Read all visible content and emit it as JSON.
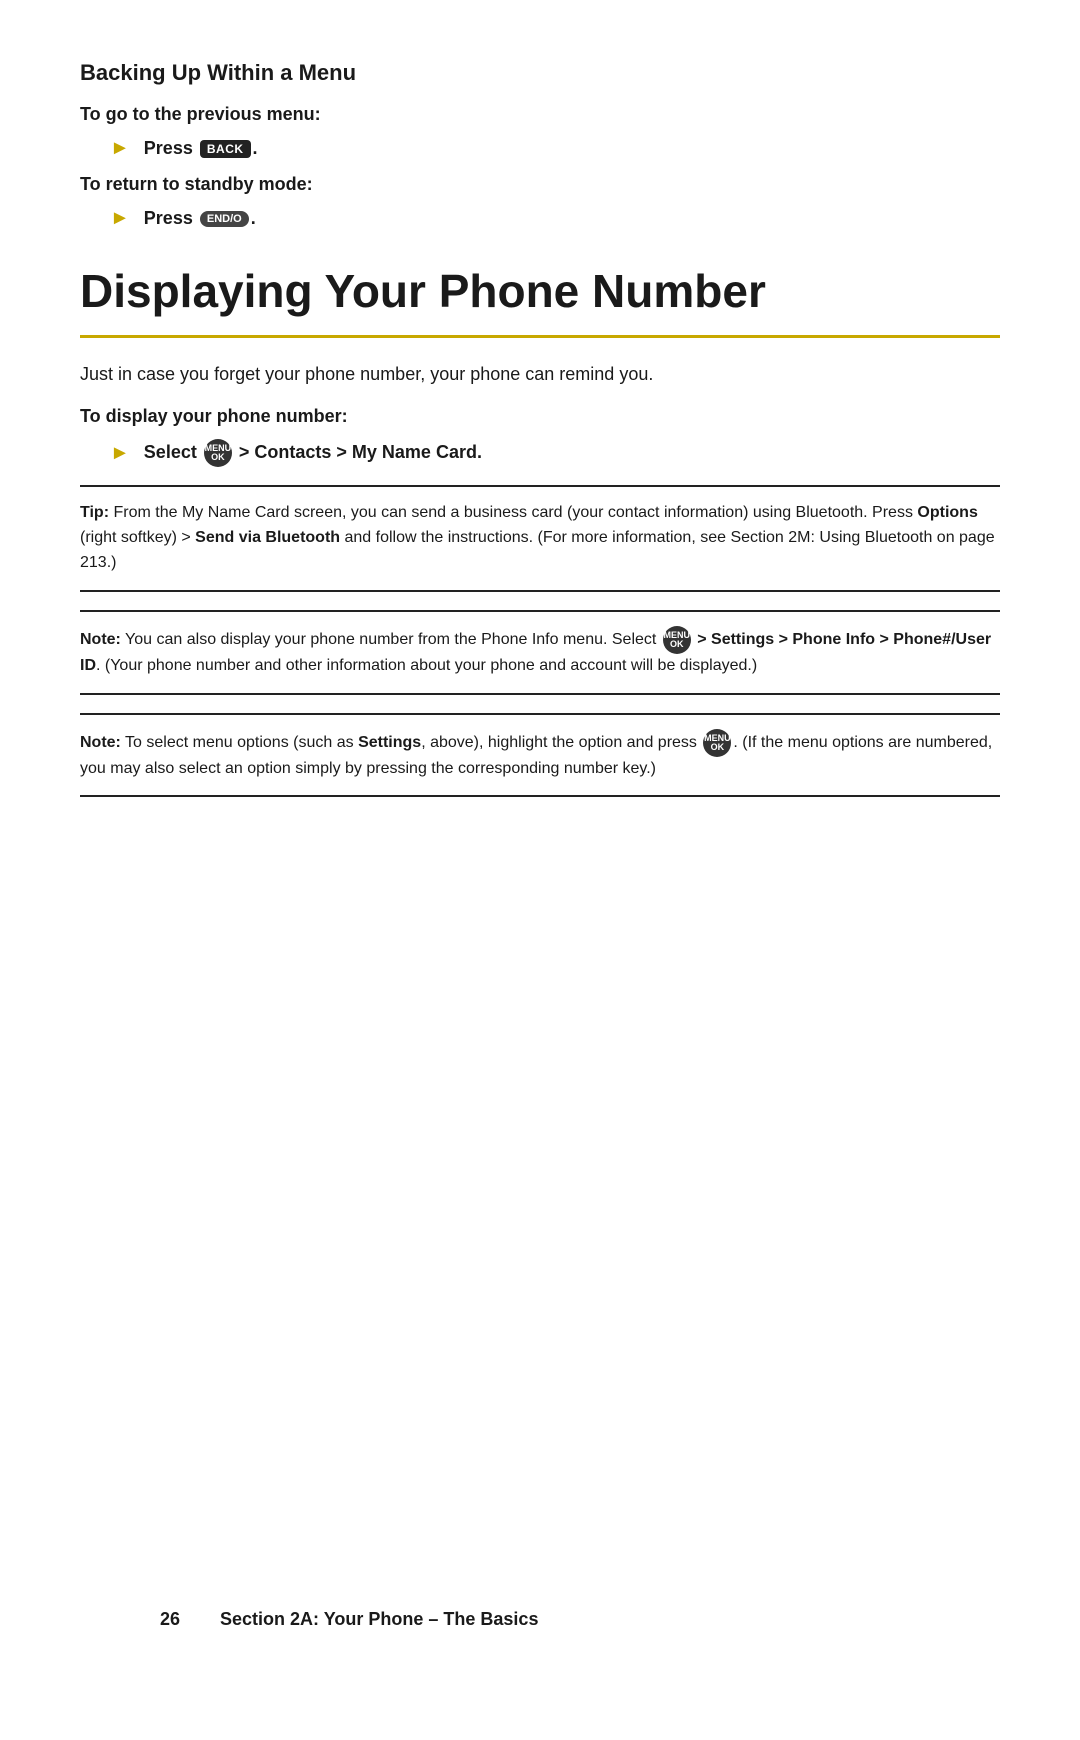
{
  "backing_up": {
    "heading": "Backing Up Within a Menu",
    "instruction1_label": "To go to the previous menu:",
    "instruction1_bullet": "Press",
    "back_key_label": "BACK",
    "instruction2_label": "To return to standby mode:",
    "instruction2_bullet": "Press",
    "end_key_label": "END/O"
  },
  "displaying": {
    "heading": "Displaying Your Phone Number",
    "body": "Just in case you forget your phone number, your phone can remind you.",
    "instruction_label": "To display your phone number:",
    "select_bullet_prefix": "Select",
    "select_bullet_path": " > Contacts > My Name Card.",
    "tip_label": "Tip:",
    "tip_text": " From the My Name Card screen, you can send a business card (your contact information) using Bluetooth. Press ",
    "tip_options": "Options",
    "tip_text2": " (right softkey) > ",
    "tip_send": "Send via Bluetooth",
    "tip_text3": " and follow the instructions. (For more information, see Section 2M: Using Bluetooth on page 213.)",
    "note1_label": "Note:",
    "note1_text": " You can also display your phone number from the Phone Info menu. Select ",
    "note1_path": " > Settings > Phone Info > Phone#/User ID",
    "note1_text2": ". (Your phone number and other information about your phone and account will be displayed.)",
    "note2_label": "Note:",
    "note2_text": " To select menu options (such as ",
    "note2_settings": "Settings",
    "note2_text2": ", above), highlight the option and press ",
    "note2_text3": ". (If the menu options are numbered, you may also select an option simply by pressing the corresponding number key.)"
  },
  "footer": {
    "page_number": "26",
    "section": "Section 2A: Your Phone – The Basics"
  }
}
